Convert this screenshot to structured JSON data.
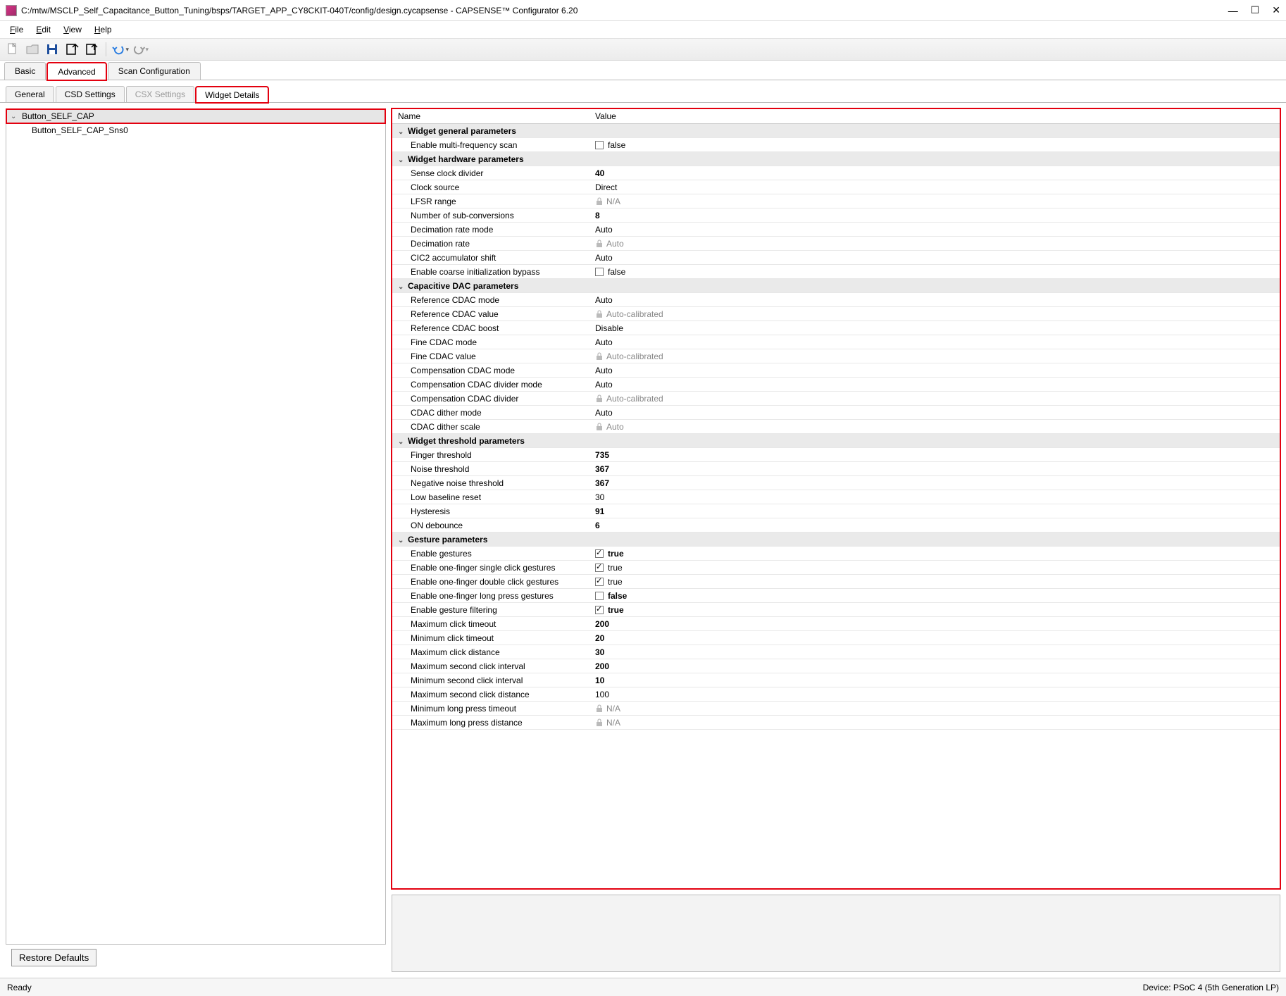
{
  "window": {
    "title": "C:/mtw/MSCLP_Self_Capacitance_Button_Tuning/bsps/TARGET_APP_CY8CKIT-040T/config/design.cycapsense - CAPSENSE™ Configurator 6.20"
  },
  "menu": {
    "file": "File",
    "edit": "Edit",
    "view": "View",
    "help": "Help"
  },
  "maintabs": {
    "basic": "Basic",
    "advanced": "Advanced",
    "scan": "Scan Configuration"
  },
  "subtabs": {
    "general": "General",
    "csd": "CSD Settings",
    "csx": "CSX Settings",
    "widget": "Widget Details"
  },
  "tree": {
    "root": "Button_SELF_CAP",
    "child": "Button_SELF_CAP_Sns0"
  },
  "restore": "Restore Defaults",
  "gridhead": {
    "name": "Name",
    "value": "Value"
  },
  "groups": {
    "g1": "Widget general parameters",
    "g2": "Widget hardware parameters",
    "g3": "Capacitive DAC parameters",
    "g4": "Widget threshold parameters",
    "g5": "Gesture parameters"
  },
  "rows": {
    "r1": {
      "n": "Enable multi-frequency scan",
      "v": "false",
      "cb": true,
      "chk": false
    },
    "r2": {
      "n": "Sense clock divider",
      "v": "40",
      "bold": true
    },
    "r3": {
      "n": "Clock source",
      "v": "Direct"
    },
    "r4": {
      "n": "LFSR range",
      "v": "N/A",
      "lock": true
    },
    "r5": {
      "n": "Number of sub-conversions",
      "v": "8",
      "bold": true
    },
    "r6": {
      "n": "Decimation rate mode",
      "v": "Auto"
    },
    "r7": {
      "n": "Decimation rate",
      "v": "Auto",
      "lock": true
    },
    "r8": {
      "n": "CIC2 accumulator shift",
      "v": "Auto"
    },
    "r9": {
      "n": "Enable coarse initialization bypass",
      "v": "false",
      "cb": true,
      "chk": false
    },
    "r10": {
      "n": "Reference CDAC mode",
      "v": "Auto"
    },
    "r11": {
      "n": "Reference CDAC value",
      "v": "Auto-calibrated",
      "lock": true
    },
    "r12": {
      "n": "Reference CDAC boost",
      "v": "Disable"
    },
    "r13": {
      "n": "Fine CDAC mode",
      "v": "Auto"
    },
    "r14": {
      "n": "Fine CDAC value",
      "v": "Auto-calibrated",
      "lock": true
    },
    "r15": {
      "n": "Compensation CDAC mode",
      "v": "Auto"
    },
    "r16": {
      "n": "Compensation CDAC divider mode",
      "v": "Auto"
    },
    "r17": {
      "n": "Compensation CDAC divider",
      "v": "Auto-calibrated",
      "lock": true
    },
    "r18": {
      "n": "CDAC dither mode",
      "v": "Auto"
    },
    "r19": {
      "n": "CDAC dither scale",
      "v": "Auto",
      "lock": true
    },
    "r20": {
      "n": "Finger threshold",
      "v": "735",
      "bold": true
    },
    "r21": {
      "n": "Noise threshold",
      "v": "367",
      "bold": true
    },
    "r22": {
      "n": "Negative noise threshold",
      "v": "367",
      "bold": true
    },
    "r23": {
      "n": "Low baseline reset",
      "v": "30"
    },
    "r24": {
      "n": "Hysteresis",
      "v": "91",
      "bold": true
    },
    "r25": {
      "n": "ON debounce",
      "v": "6",
      "bold": true
    },
    "r26": {
      "n": "Enable gestures",
      "v": "true",
      "cb": true,
      "chk": true,
      "bold": true
    },
    "r27": {
      "n": "Enable one-finger single click gestures",
      "v": "true",
      "cb": true,
      "chk": true
    },
    "r28": {
      "n": "Enable one-finger double click gestures",
      "v": "true",
      "cb": true,
      "chk": true
    },
    "r29": {
      "n": "Enable one-finger long press gestures",
      "v": "false",
      "cb": true,
      "chk": false,
      "bold": true
    },
    "r30": {
      "n": "Enable gesture filtering",
      "v": "true",
      "cb": true,
      "chk": true,
      "bold": true
    },
    "r31": {
      "n": "Maximum click timeout",
      "v": "200",
      "bold": true
    },
    "r32": {
      "n": "Minimum click timeout",
      "v": "20",
      "bold": true
    },
    "r33": {
      "n": "Maximum click distance",
      "v": "30",
      "bold": true
    },
    "r34": {
      "n": "Maximum second click interval",
      "v": "200",
      "bold": true
    },
    "r35": {
      "n": "Minimum second click interval",
      "v": "10",
      "bold": true
    },
    "r36": {
      "n": "Maximum second click distance",
      "v": "100"
    },
    "r37": {
      "n": "Minimum long press timeout",
      "v": "N/A",
      "lock": true
    },
    "r38": {
      "n": "Maximum long press distance",
      "v": "N/A",
      "lock": true
    }
  },
  "status": {
    "left": "Ready",
    "right": "Device: PSoC 4 (5th Generation LP)"
  }
}
